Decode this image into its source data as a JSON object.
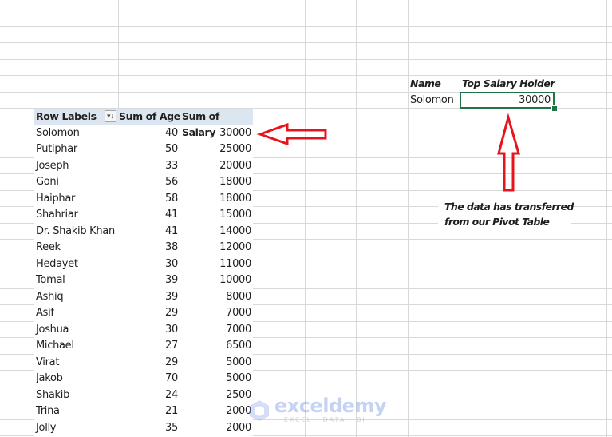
{
  "pivot": {
    "headers": {
      "row_labels": "Row Labels",
      "sum_age": "Sum of Age",
      "sum_salary": "Sum of Salary"
    },
    "filter_icon": "sort-filter-dropdown-icon",
    "rows": [
      {
        "name": "Solomon",
        "age": "40",
        "salary": "30000"
      },
      {
        "name": "Putiphar",
        "age": "50",
        "salary": "25000"
      },
      {
        "name": "Joseph",
        "age": "33",
        "salary": "20000"
      },
      {
        "name": "Goni",
        "age": "56",
        "salary": "18000"
      },
      {
        "name": "Haiphar",
        "age": "58",
        "salary": "18000"
      },
      {
        "name": "Shahriar",
        "age": "41",
        "salary": "15000"
      },
      {
        "name": "Dr. Shakib Khan",
        "age": "41",
        "salary": "14000"
      },
      {
        "name": "Reek",
        "age": "38",
        "salary": "12000"
      },
      {
        "name": "Hedayet",
        "age": "30",
        "salary": "11000"
      },
      {
        "name": "Tomal",
        "age": "39",
        "salary": "10000"
      },
      {
        "name": "Ashiq",
        "age": "39",
        "salary": "8000"
      },
      {
        "name": "Asif",
        "age": "29",
        "salary": "7000"
      },
      {
        "name": "Joshua",
        "age": "30",
        "salary": "7000"
      },
      {
        "name": "Michael",
        "age": "27",
        "salary": "6500"
      },
      {
        "name": "Virat",
        "age": "29",
        "salary": "5000"
      },
      {
        "name": "Jakob",
        "age": "70",
        "salary": "5000"
      },
      {
        "name": "Shakib",
        "age": "24",
        "salary": "2500"
      },
      {
        "name": "Trina",
        "age": "21",
        "salary": "2000"
      },
      {
        "name": "Jolly",
        "age": "35",
        "salary": "2000"
      }
    ]
  },
  "result": {
    "name_header": "Name",
    "top_header": "Top Salary Holder",
    "name_value": "Solomon",
    "top_value": "30000"
  },
  "annotation": {
    "line1": "The data has transferred",
    "line2": "from our Pivot Table",
    "arrow_color": "#e8141b"
  },
  "watermark": {
    "brand": "exceldemy",
    "tagline": "EXCEL · DATA · BI"
  },
  "colors": {
    "gridline": "#d9d9d9",
    "pivot_header_bg": "#dce6f1",
    "selection": "#217346"
  }
}
